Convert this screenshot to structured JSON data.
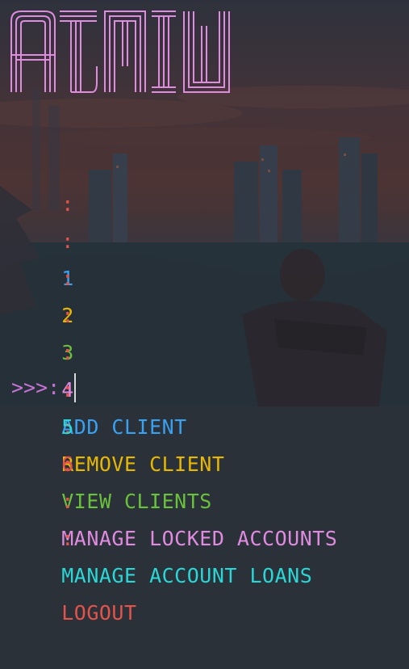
{
  "banner": {
    "text": "ADMIN",
    "color": "#e08ae0"
  },
  "menu": [
    {
      "number": "1",
      "label": "ADD CLIENT",
      "color": "#3aa0f0"
    },
    {
      "number": "2",
      "label": "REMOVE CLIENT",
      "color": "#e8b800"
    },
    {
      "number": "3",
      "label": "VIEW CLIENTS",
      "color": "#6ac23c"
    },
    {
      "number": "4",
      "label": "MANAGE LOCKED ACCOUNTS",
      "color": "#e08ae0"
    },
    {
      "number": "5",
      "label": "MANAGE ACCOUNT LOANS",
      "color": "#2ad6d6"
    },
    {
      "number": "6",
      "label": "LOGOUT",
      "color": "#e5534b"
    }
  ],
  "separator": ":",
  "separator_color": "#e5534b",
  "prompt": {
    "text": ">>>:",
    "value": ""
  }
}
